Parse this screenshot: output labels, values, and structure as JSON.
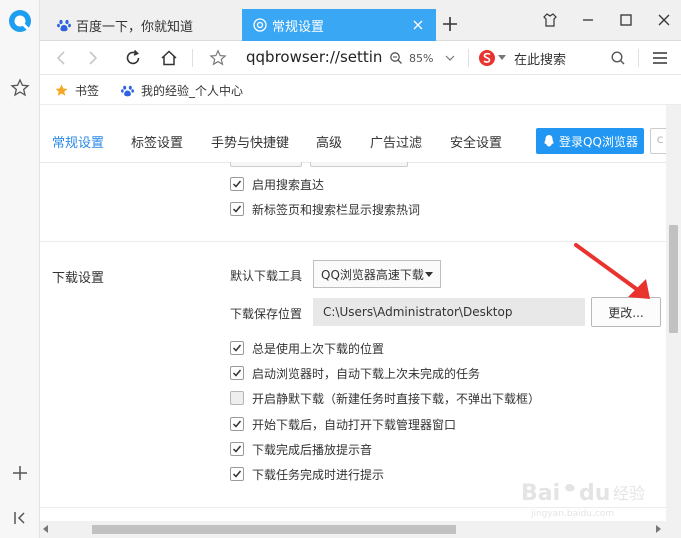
{
  "tabs": [
    {
      "label": "百度一下，你就知道",
      "active": false
    },
    {
      "label": "常规设置",
      "active": true
    }
  ],
  "toolbar": {
    "url": "qqbrowser://settin",
    "zoom": "85%",
    "search_placeholder": "在此搜索"
  },
  "bookmarks": {
    "items": [
      {
        "label": "书签",
        "icon": "star-icon"
      },
      {
        "label": "我的经验_个人中心",
        "icon": "baidu-paw-icon"
      }
    ]
  },
  "settings_nav": {
    "tabs": [
      "常规设置",
      "标签设置",
      "手势与快捷键",
      "高级",
      "广告过滤",
      "安全设置"
    ],
    "active_index": 0,
    "login_label": "登录QQ浏览器",
    "stub_label": "C"
  },
  "search_options": [
    {
      "label": "启用搜索直达",
      "checked": true
    },
    {
      "label": "新标签页和搜索栏显示搜索热词",
      "checked": true
    }
  ],
  "download": {
    "section_title": "下载设置",
    "default_tool_label": "默认下载工具",
    "default_tool_value": "QQ浏览器高速下载",
    "save_path_label": "下载保存位置",
    "save_path_value": "C:\\Users\\Administrator\\Desktop",
    "change_button": "更改...",
    "options": [
      {
        "label": "总是使用上次下载的位置",
        "checked": true
      },
      {
        "label": "启动浏览器时，自动下载上次未完成的任务",
        "checked": true
      },
      {
        "label": "开启静默下载（新建任务时直接下载，不弹出下载框）",
        "checked": false
      },
      {
        "label": "开始下载后，自动打开下载管理器窗口",
        "checked": true
      },
      {
        "label": "下载完成后播放提示音",
        "checked": true
      },
      {
        "label": "下载任务完成时进行提示",
        "checked": true
      }
    ]
  },
  "colors": {
    "accent": "#3aa7f4",
    "nav_active": "#2b8ae8",
    "login_button": "#2196f3",
    "annotation_arrow": "#e8332f"
  },
  "watermark": {
    "text": "Bai du 经验",
    "subtext": "jingyan.baidu.com"
  }
}
